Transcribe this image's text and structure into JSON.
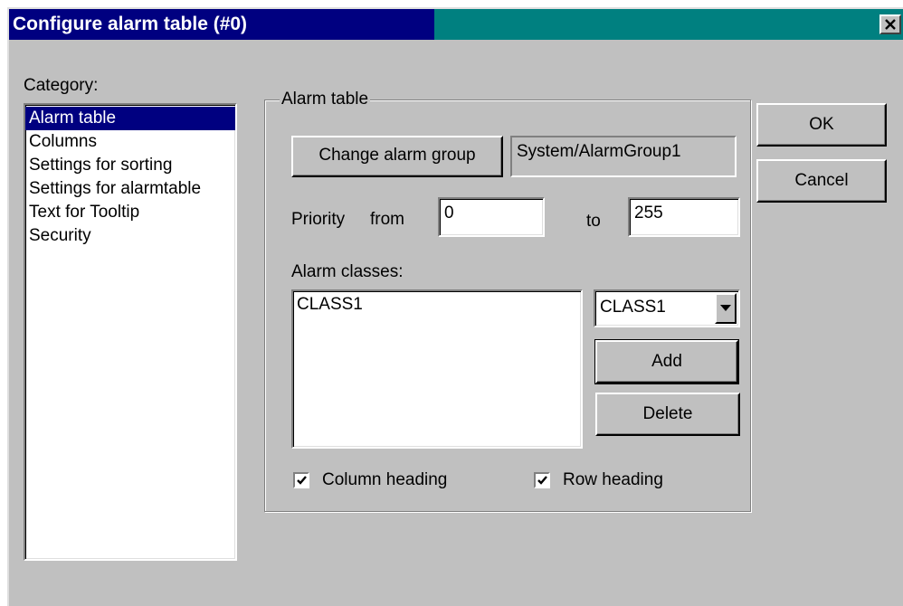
{
  "window": {
    "title": "Configure alarm table (#0)",
    "close_glyph": "✕"
  },
  "category": {
    "label": "Category:",
    "items": [
      {
        "label": "Alarm table",
        "selected": true
      },
      {
        "label": "Columns",
        "selected": false
      },
      {
        "label": "Settings for sorting",
        "selected": false
      },
      {
        "label": "Settings for alarmtable",
        "selected": false
      },
      {
        "label": "Text for Tooltip",
        "selected": false
      },
      {
        "label": "Security",
        "selected": false
      }
    ]
  },
  "alarm_table": {
    "group_title": "Alarm table",
    "change_group_label": "Change alarm group",
    "alarm_group_value": "System/AlarmGroup1",
    "priority_label": "Priority",
    "from_label": "from",
    "from_value": "0",
    "to_label": "to",
    "to_value": "255",
    "classes_label": "Alarm classes:",
    "classes_list": [
      "CLASS1"
    ],
    "class_select_value": "CLASS1",
    "add_label": "Add",
    "delete_label": "Delete",
    "column_heading_label": "Column heading",
    "column_heading_checked": true,
    "row_heading_label": "Row heading",
    "row_heading_checked": true
  },
  "actions": {
    "ok_label": "OK",
    "cancel_label": "Cancel"
  }
}
